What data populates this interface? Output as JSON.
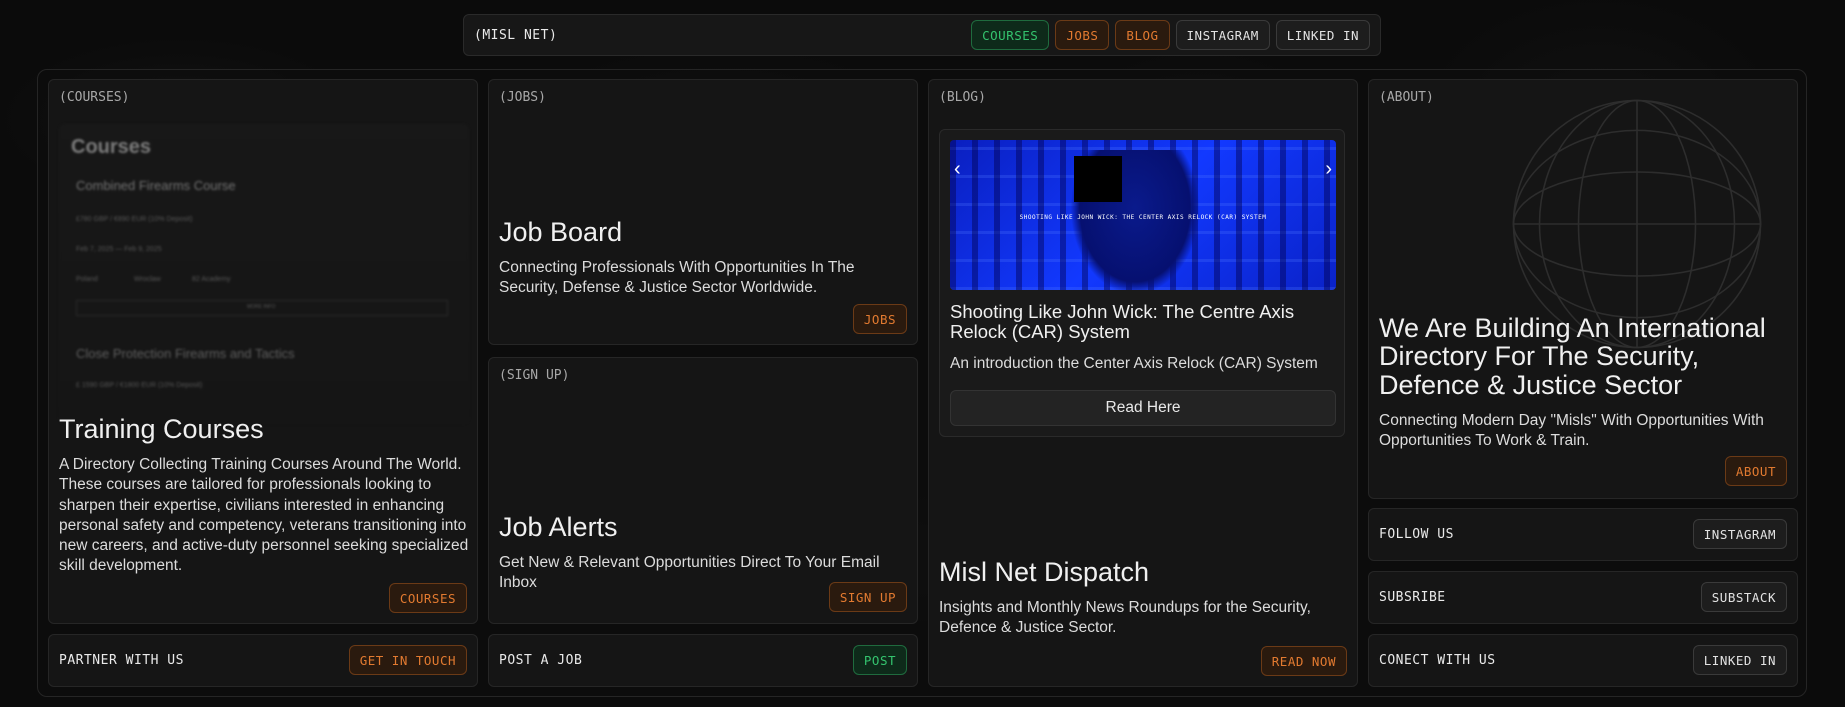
{
  "nav": {
    "brand": "(MISL NET)",
    "buttons": [
      "COURSES",
      "JOBS",
      "BLOG",
      "INSTAGRAM",
      "LINKED IN"
    ]
  },
  "courses": {
    "tag": "(COURSES)",
    "title": "Training Courses",
    "desc": "A Directory Collecting Training Courses Around The World. These courses are tailored for professionals looking to sharpen their expertise, civilians interested in enhancing personal safety and competency, veterans transitioning into new careers, and active-duty personnel seeking specialized skill development.",
    "cta": "COURSES",
    "preview": {
      "heading": "Courses",
      "course1": "Combined Firearms Course",
      "course1_price": "£780 GBP / €890 EUR (10% Deposit)",
      "course1_dates": "Feb 7, 2025 — Feb 9, 2025",
      "course1_country": "Poland",
      "course1_city": "Wroclaw",
      "course1_provider": "82 Academy",
      "more": "MORE INFO",
      "course2": "Close Protection Firearms and Tactics",
      "course2_price": "£ 1590 GBP / €1800 EUR (10% Deposit)"
    }
  },
  "jobs": {
    "tag": "(JOBS)",
    "title": "Job Board",
    "desc": "Connecting Professionals With Opportunities In The Security, Defense & Justice Sector Worldwide.",
    "cta": "JOBS"
  },
  "signup": {
    "tag": "(SIGN UP)",
    "title": "Job Alerts",
    "desc": "Get New & Relevant Opportunities Direct To Your Email Inbox",
    "cta": "SIGN UP"
  },
  "blog": {
    "tag": "(BLOG)",
    "image_text": "SHOOTING LIKE JOHN WICK: THE CENTER AXIS RELOCK (CAR) SYSTEM",
    "post_title": "Shooting Like John Wick: The Centre Axis Relock (CAR) System",
    "post_desc": "An introduction the Center Axis Relock (CAR) System",
    "read_label": "Read Here",
    "dispatch_title": "Misl Net Dispatch",
    "dispatch_desc": "Insights and Monthly News Roundups for the Security, Defence & Justice Sector.",
    "cta": "READ NOW"
  },
  "about": {
    "tag": "(ABOUT)",
    "title": "We Are Building An International Directory For The Security, Defence & Justice Sector",
    "desc": "Connecting Modern Day \"Misls\" With Opportunities With Opportunities To Work & Train.",
    "cta": "ABOUT"
  },
  "strips": {
    "partner": {
      "label": "PARTNER WITH US",
      "cta": "GET IN TOUCH"
    },
    "post": {
      "label": "POST A JOB",
      "cta": "POST"
    },
    "follow": {
      "label": "FOLLOW US",
      "cta": "INSTAGRAM"
    },
    "subscribe": {
      "label": "SUBSRIBE",
      "cta": "SUBSTACK"
    },
    "connect": {
      "label": "CONECT WITH US",
      "cta": "LINKED IN"
    }
  }
}
